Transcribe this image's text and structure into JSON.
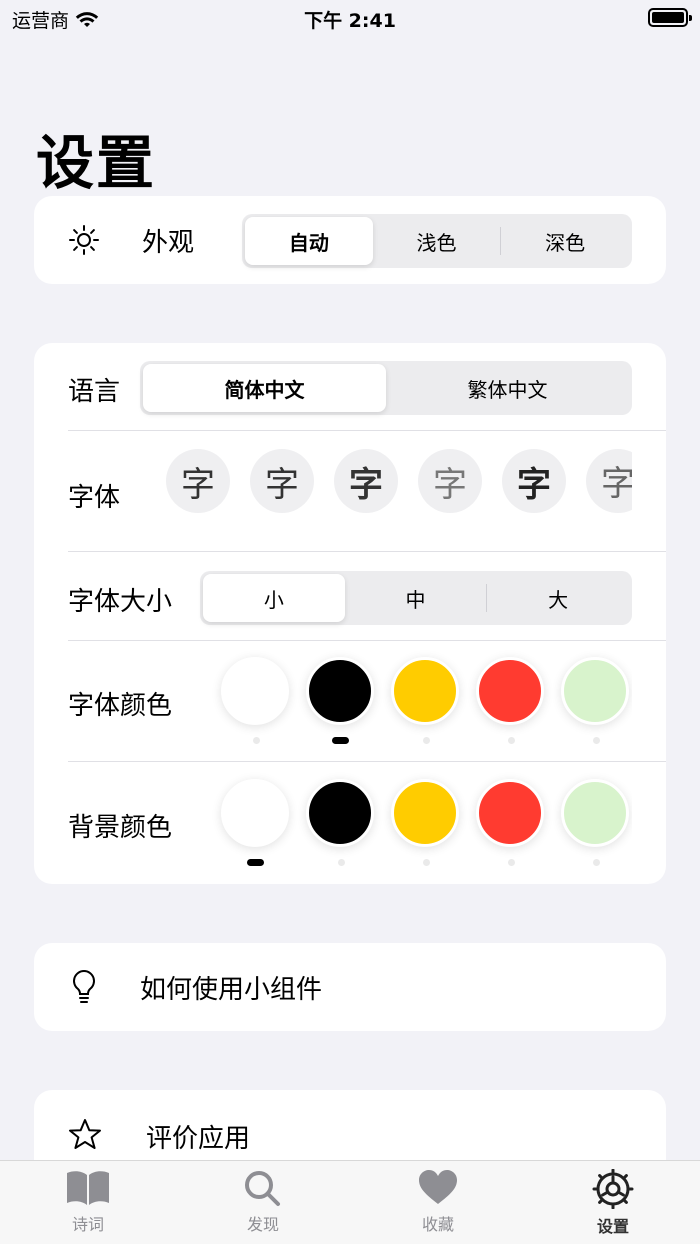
{
  "status": {
    "carrier": "运营商",
    "time": "下午 2:41"
  },
  "title": "设置",
  "appearance": {
    "label": "外观",
    "icon": "sun-icon",
    "options": [
      "自动",
      "浅色",
      "深色"
    ],
    "selected": 0
  },
  "language": {
    "label": "语言",
    "options": [
      "简体中文",
      "繁体中文"
    ],
    "selected": 0
  },
  "font": {
    "label": "字体",
    "glyph": "字",
    "selected": 0
  },
  "font_size": {
    "label": "字体大小",
    "options": [
      "小",
      "中",
      "大"
    ],
    "selected": 0
  },
  "font_color": {
    "label": "字体颜色",
    "colors": [
      "#ffffff",
      "#000000",
      "#ffcc00",
      "#ff3b30",
      "#d8f3cc"
    ],
    "selected": 1
  },
  "bg_color": {
    "label": "背景颜色",
    "colors": [
      "#ffffff",
      "#000000",
      "#ffcc00",
      "#ff3b30",
      "#d8f3cc"
    ],
    "selected": 0
  },
  "widget_help": {
    "label": "如何使用小组件",
    "icon": "lightbulb-icon"
  },
  "rate_app": {
    "label": "评价应用",
    "icon": "star-icon"
  },
  "tabs": [
    {
      "label": "诗词",
      "icon": "book-icon"
    },
    {
      "label": "发现",
      "icon": "search-icon"
    },
    {
      "label": "收藏",
      "icon": "heart-icon"
    },
    {
      "label": "设置",
      "icon": "gear-icon"
    }
  ],
  "active_tab": 3
}
